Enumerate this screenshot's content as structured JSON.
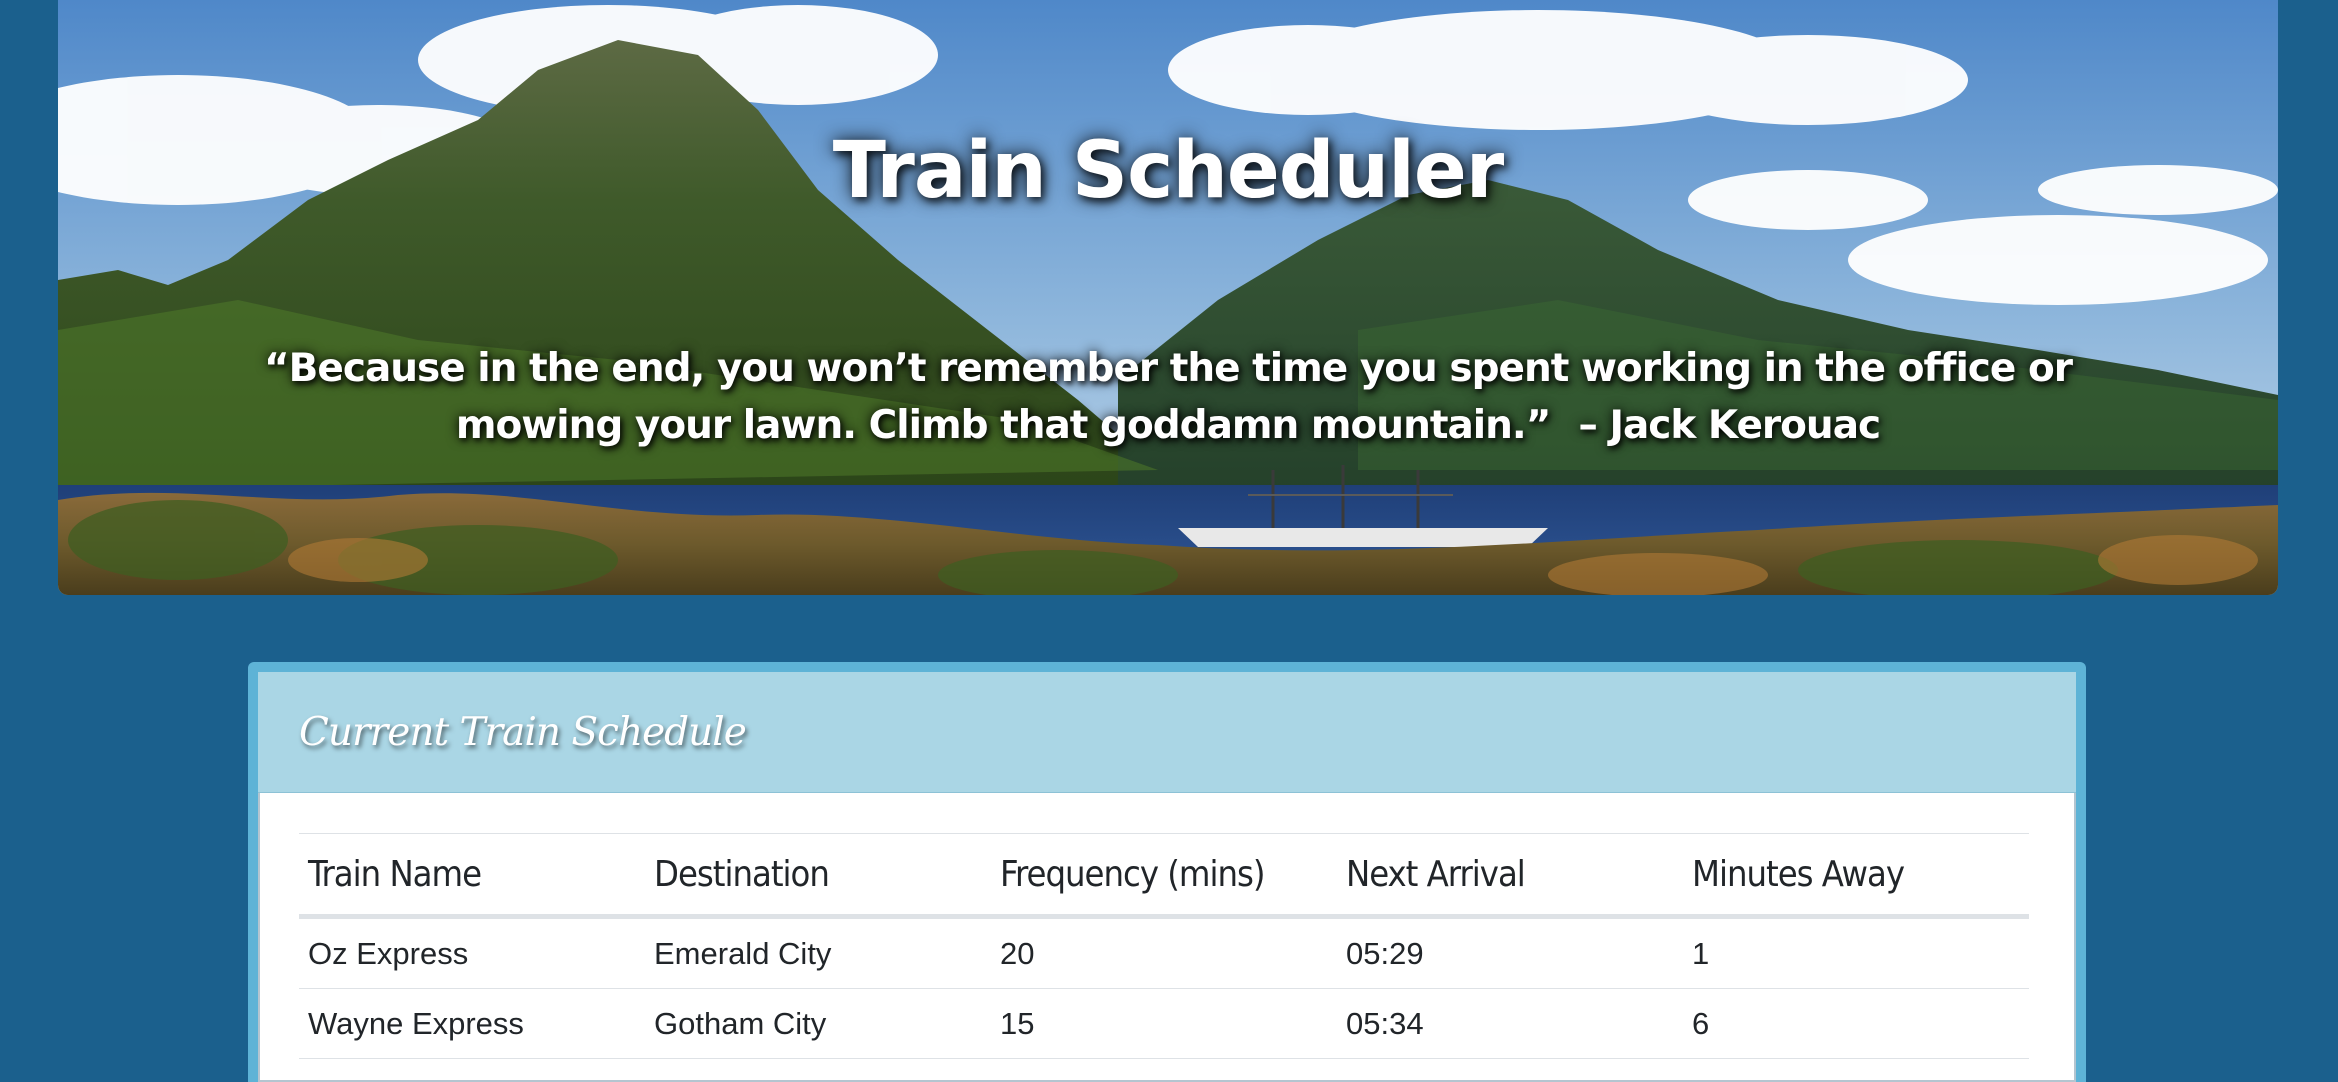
{
  "header": {
    "title": "Train Scheduler",
    "quote": "“Because in the end, you won’t remember the time you spent working in the office or mowing your lawn. Climb that goddamn mountain.”",
    "quote_author": "– Jack Kerouac"
  },
  "schedule": {
    "title": "Current Train Schedule",
    "columns": [
      "Train Name",
      "Destination",
      "Frequency (mins)",
      "Next Arrival",
      "Minutes Away"
    ],
    "rows": [
      [
        "Oz Express",
        "Emerald City",
        "20",
        "05:29",
        "1"
      ],
      [
        "Wayne Express",
        "Gotham City",
        "15",
        "05:34",
        "6"
      ]
    ]
  },
  "colors": {
    "page_background": "#1b608d",
    "panel_border": "#5eb3d6",
    "panel_heading": "#aad6e5"
  }
}
